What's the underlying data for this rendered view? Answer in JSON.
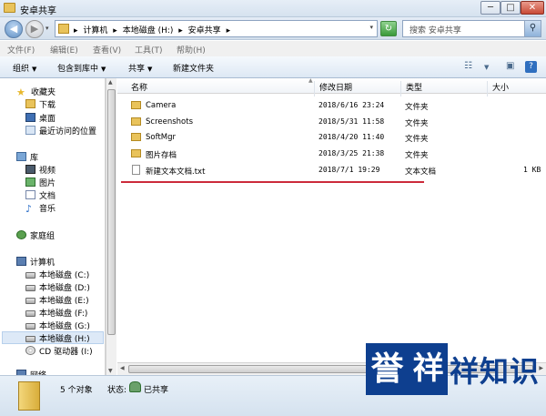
{
  "window": {
    "title": "安卓共享",
    "minimize": "─",
    "maximize": "□",
    "close": "✕",
    "icon": "folder-icon"
  },
  "address": {
    "crumbs": [
      "▸",
      "计算机",
      "▸",
      "本地磁盘 (H:)",
      "▸",
      "安卓共享",
      "▸"
    ],
    "dropdown": "▾"
  },
  "nav_buttons": {
    "back": "◀",
    "forward": "▶",
    "history_drop": "▾",
    "refresh": "↻"
  },
  "search": {
    "placeholder": "搜索 安卓共享",
    "icon": "search-icon",
    "glyph": "⚲"
  },
  "menu": {
    "items": [
      "文件(F)",
      "编辑(E)",
      "查看(V)",
      "工具(T)",
      "帮助(H)"
    ]
  },
  "toolbar": {
    "organize": "组织",
    "include_in_library": "包含到库中",
    "share": "共享",
    "new_folder": "新建文件夹",
    "drop_arrow": "▼",
    "view_icon": "☷",
    "pane_icon": "▣",
    "help_icon": "?"
  },
  "sidebar": {
    "favorites": {
      "label": "收藏夹",
      "items": [
        "下载",
        "桌面",
        "最近访问的位置"
      ]
    },
    "libraries": {
      "label": "库",
      "items": [
        "视频",
        "图片",
        "文档",
        "音乐"
      ]
    },
    "homegroup": "家庭组",
    "computer": {
      "label": "计算机",
      "drives": [
        "本地磁盘 (C:)",
        "本地磁盘 (D:)",
        "本地磁盘 (E:)",
        "本地磁盘 (F:)",
        "本地磁盘 (G:)",
        "本地磁盘 (H:)",
        "CD 驱动器 (I:)"
      ],
      "selected_drive": "本地磁盘 (H:)"
    },
    "network_partial": "网络"
  },
  "columns": {
    "name": "名称",
    "modified": "修改日期",
    "type": "类型",
    "size": "大小",
    "sort_indicator": "▲"
  },
  "files": [
    {
      "name": "Camera",
      "modified": "2018/6/16 23:24",
      "type": "文件夹",
      "size": "",
      "kind": "folder"
    },
    {
      "name": "Screenshots",
      "modified": "2018/5/31 11:58",
      "type": "文件夹",
      "size": "",
      "kind": "folder"
    },
    {
      "name": "SoftMgr",
      "modified": "2018/4/20 11:40",
      "type": "文件夹",
      "size": "",
      "kind": "folder"
    },
    {
      "name": "图片存档",
      "modified": "2018/3/25 21:38",
      "type": "文件夹",
      "size": "",
      "kind": "folder"
    },
    {
      "name": "新建文本文档.txt",
      "modified": "2018/7/1 19:29",
      "type": "文本文档",
      "size": "1 KB",
      "kind": "text"
    }
  ],
  "highlight_color": "#cc2a3a",
  "status": {
    "count": "5 个对象",
    "state_label": "状态:",
    "state_value": "已共享"
  },
  "watermark": {
    "char1": "誉",
    "char2": "祥",
    "text": "祥知识",
    "color": "#0e3f8f"
  }
}
